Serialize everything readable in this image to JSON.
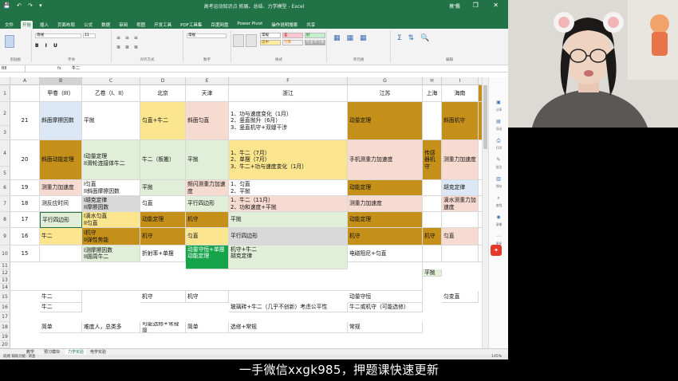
{
  "window": {
    "title": "高考运动知识点 拓展、总结、力学模型 - Excel",
    "user": "蔡 晨",
    "quick_access": "💾 ↶ ↷ ▾",
    "controls": "─ ❐ ✕",
    "tabs": [
      "文件",
      "开始",
      "插入",
      "页面布局",
      "公式",
      "数据",
      "审阅",
      "视图",
      "开发工具",
      "PDF工具集",
      "百度网盘",
      "Power Pivot",
      "操作说明搜索"
    ],
    "share": "共享"
  },
  "ribbon": {
    "groups": [
      "剪贴板",
      "字体",
      "对齐方式",
      "数字",
      "样式",
      "单元格",
      "编辑"
    ],
    "font_name": "等线",
    "font_size": "11",
    "number_format": "常规",
    "style_normal": "常规",
    "style_bad": "差",
    "style_good": "好",
    "style_neutral": "适中",
    "style_calc": "计算",
    "style_check": "检查单元格"
  },
  "formula_bar": {
    "name_box": "B8",
    "fx": "fx",
    "value": "牛二"
  },
  "columns": [
    "A",
    "B",
    "C",
    "D",
    "E",
    "F",
    "G",
    "H",
    "I"
  ],
  "header_row": {
    "row": "1",
    "B": "甲卷（III）",
    "C": "乙卷（I、II）",
    "D": "北京",
    "E": "天津",
    "F": "浙江",
    "G": "江苏",
    "H": "上海",
    "I": "海南"
  },
  "rows": {
    "r2": {
      "row": "2",
      "A": "21",
      "B": "斜面摩擦因数",
      "C": "平抛",
      "D": "匀直+牛二",
      "E": "斜面匀直",
      "F": "1、功与速度变化（1月）\n2、竖直抛升（6月）\n3、竖直机守+双缝干涉",
      "G": "动量定理",
      "I": "斜面机守"
    },
    "r3": {
      "row": "3"
    },
    "r4": {
      "row": "4",
      "A": "20",
      "B": "斜面动能定理",
      "C": "I动量定理\nII滑轮连接体牛二",
      "D": "牛二（板搬）",
      "E": "平抛",
      "F": "1、牛二（7月）\n2、单摆（7月）\n3、牛二+功与速度变化（1月）",
      "G": "手机测重力加速度",
      "H": "传感器机守",
      "I": "测重力加速度"
    },
    "r5": {
      "row": "5"
    },
    "r6": {
      "row": "6",
      "A": "19",
      "B": "测重力加速度",
      "C": "I匀直\nII斜面摩擦因数",
      "D": "平抛",
      "E": "频闪测重力加速度",
      "F": "1、匀直\n2、平抛",
      "G": "动能定理",
      "I": "胡克定律"
    },
    "r7": {
      "row": "7",
      "A": "18",
      "B": "测反应时间",
      "C": "I胡克定律\nII摩擦因数",
      "D": "匀直",
      "E": "平行四边形",
      "F": "1、牛二（11月）\n2、功和速度+平抛",
      "G": "测重力加速度",
      "I": "滴水测重力加速度"
    },
    "r8": {
      "row": "8",
      "A": "17",
      "B": "平行四边形",
      "C": "I滴水匀直\nII匀直",
      "D": "动能定理",
      "E": "机守",
      "F": "平抛",
      "G": "动能定理"
    },
    "r9": {
      "row": "9",
      "A": "16",
      "B": "牛二",
      "C": "I机守\nII弹性势能",
      "D": "机守",
      "E": "匀直",
      "F": "平行四边形",
      "G": "机守",
      "H": "机守",
      "I": "匀直"
    },
    "r10": {
      "row": "10",
      "A": "15",
      "C": "I测摩擦因数\nII圆周牛二",
      "D": "折射率+单摆",
      "E": "动量守恒+单摆\n动能定理",
      "F": "机守+牛二\n胡克定律",
      "G": "电磁阻尼+匀直"
    },
    "r11": {
      "row": "11"
    },
    "r12": {
      "row": "12",
      "H": "平抛"
    },
    "r13": {
      "row": "13"
    },
    "r14": {
      "row": "14"
    },
    "r15": {
      "row": "15",
      "B": "牛二",
      "D": "机守",
      "E": "机守",
      "G": "动量守恒",
      "I": "匀变直"
    },
    "r16": {
      "row": "16",
      "B": "牛二",
      "F": "玻璃砖+牛二（几乎不创新）考虑公平性",
      "G": "牛二或机守（可能选修）"
    },
    "r17": {
      "row": "17"
    },
    "r18": {
      "row": "18",
      "B": "简单",
      "C": "难度人，总类多",
      "D": "可能选修+常规简",
      "E": "简单",
      "F": "选修+常规",
      "G": "常规"
    },
    "r19": {
      "row": "19"
    },
    "r20": {
      "row": "20"
    }
  },
  "sheet_tabs": [
    "教学",
    "预习模块",
    "力学实验",
    "电学实验"
  ],
  "active_sheet": "力学实验",
  "status": {
    "left": "就绪  辅助功能: 调查",
    "zoom": "145%"
  },
  "side_panel": [
    "分享",
    "导出",
    "打印",
    "批注",
    "保存",
    "查找",
    "录像",
    "更多"
  ],
  "subtitle": "一手微信xxgk985，押题课快速更新",
  "colors": {
    "excel_green": "#217346",
    "yellow": "#fce58f",
    "orange_tan": "#c5901a",
    "peach": "#f8dbd0",
    "light_green": "#e1efd8",
    "light_blue": "#dbe7f4",
    "gray": "#d9d9d9",
    "bright_green": "#16a34a"
  }
}
